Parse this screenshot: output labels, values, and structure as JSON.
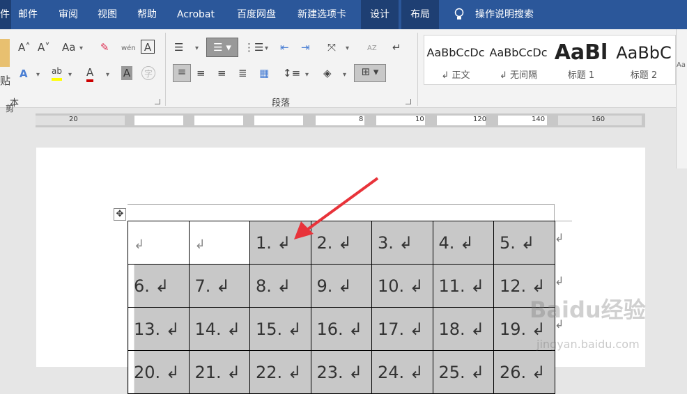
{
  "ribbon": {
    "left_tab": "件",
    "tabs": [
      "邮件",
      "审阅",
      "视图",
      "帮助",
      "Acrobat",
      "百度网盘",
      "新建选项卡",
      "设计",
      "布局"
    ],
    "search_label": "操作说明搜索"
  },
  "groups": {
    "font_label": "本",
    "paragraph_label": "段落",
    "paste_label": "贴",
    "clip_label": "剪"
  },
  "icons": {
    "grow_font": "A˄",
    "shrink_font": "A˅",
    "change_case": "Aa",
    "pinyin": "wén",
    "char_border": "A",
    "text_effect": "A",
    "highlight": "ab",
    "font_color": "A",
    "char_shading": "A",
    "enclose_char": "字",
    "sort": "AZ",
    "pilcrow": "↵"
  },
  "styles": [
    {
      "sample": "AaBbCcDc",
      "name": "↲ 正文"
    },
    {
      "sample": "AaBbCcDc",
      "name": "↲ 无间隔"
    },
    {
      "sample": "AaBl",
      "name": "标题 1"
    },
    {
      "sample": "AaBbC",
      "name": "标题 2"
    }
  ],
  "styles_more": "Aa",
  "ruler": {
    "numbers": [
      "20",
      "8",
      "10",
      "120",
      "140",
      "160"
    ]
  },
  "table": {
    "rows": [
      [
        "↲",
        "↲",
        "1. ↲",
        "2. ↲",
        "3. ↲",
        "4. ↲",
        "5. ↲"
      ],
      [
        "6. ↲",
        "7. ↲",
        "8. ↲",
        "9. ↲",
        "10. ↲",
        "11. ↲",
        "12. ↲"
      ],
      [
        "13. ↲",
        "14. ↲",
        "15. ↲",
        "16. ↲",
        "17. ↲",
        "18. ↲",
        "19. ↲"
      ],
      [
        "20. ↲",
        "21. ↲",
        "22. ↲",
        "23. ↲",
        "24. ↲",
        "25. ↲",
        "26. ↲"
      ]
    ],
    "row_end_mark": "↲",
    "move_handle": "✥"
  },
  "watermark": {
    "brand": "Baidu经验",
    "url": "jingyan.baidu.com"
  },
  "colors": {
    "ribbon": "#2b579a",
    "selection": "#c8c8c8",
    "arrow": "#e8333a"
  }
}
